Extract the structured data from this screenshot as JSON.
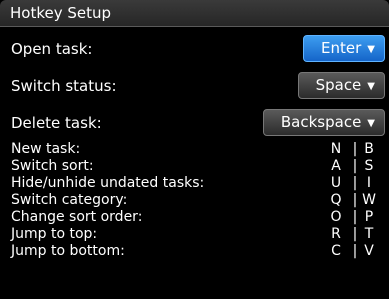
{
  "window": {
    "title": "Hotkey Setup"
  },
  "settings": [
    {
      "label": "Open task:",
      "value": "Enter"
    },
    {
      "label": "Switch status:",
      "value": "Space"
    },
    {
      "label": "Delete task:",
      "value": "Backspace"
    }
  ],
  "hotkeys": [
    {
      "name": "New task:",
      "key1": "N",
      "separator": "|",
      "key2": "B"
    },
    {
      "name": "Switch sort:",
      "key1": "A",
      "separator": "|",
      "key2": "S"
    },
    {
      "name": "Hide/unhide undated tasks:",
      "key1": "U",
      "separator": "|",
      "key2": "I"
    },
    {
      "name": "Switch category:",
      "key1": "Q",
      "separator": "|",
      "key2": "W"
    },
    {
      "name": "Change sort order:",
      "key1": "O",
      "separator": "|",
      "key2": "P"
    },
    {
      "name": "Jump to top:",
      "key1": "R",
      "separator": "|",
      "key2": "T"
    },
    {
      "name": "Jump to bottom:",
      "key1": "C",
      "separator": "|",
      "key2": "V"
    }
  ],
  "icons": {
    "dropdown_caret": "caret-down-icon"
  },
  "colors": {
    "background": "#000000",
    "focus_accent": "#1f7fe0",
    "text": "#ffffff"
  }
}
